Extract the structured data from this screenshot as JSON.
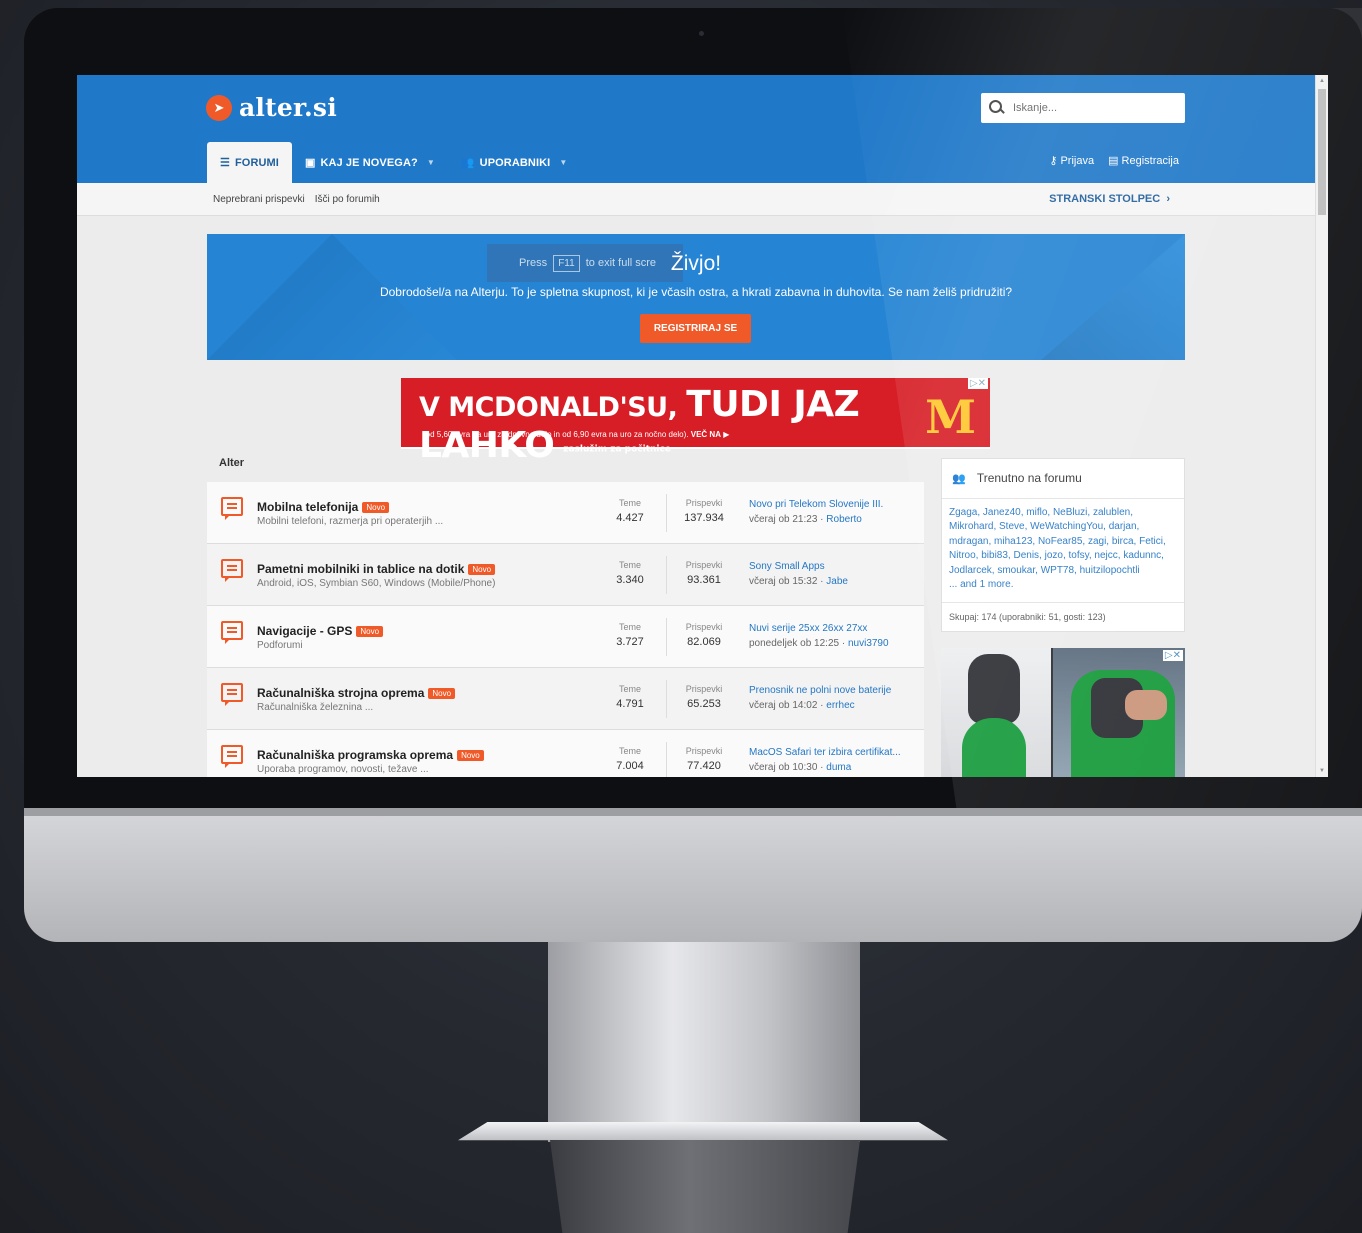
{
  "site": {
    "logo_text": "alter.si"
  },
  "search": {
    "placeholder": "Iskanje..."
  },
  "nav": {
    "tabs": [
      {
        "label": "FORUMI",
        "icon": "forum-icon"
      },
      {
        "label": "KAJ JE NOVEGA?",
        "icon": "comment-icon"
      },
      {
        "label": "UPORABNIKI",
        "icon": "users-icon"
      }
    ],
    "login": "Prijava",
    "register": "Registracija"
  },
  "subnav": {
    "unread": "Neprebrani prispevki",
    "search_forums": "Išči po forumih",
    "sidebar_toggle": "STRANSKI STOLPEC"
  },
  "fullscreen_hint": {
    "press": "Press",
    "key": "F11",
    "rest": "to exit full scre"
  },
  "banner": {
    "title": "Živjo!",
    "text": "Dobrodošel/a na Alterju. To je spletna skupnost, ki je včasih ostra, a hkrati zabavna in duhovita. Se nam želiš pridružiti?",
    "button": "REGISTRIRAJ SE"
  },
  "ad": {
    "headline_a": "V MCDONALD'SU,",
    "headline_b": "TUDI JAZ LAHKO",
    "headline_c": "zaslužim za počitnice",
    "subline": "(od 5,60 evra na uro za dnevno delo in od 6,90 evra na uro za nočno delo).",
    "cta": "VEČ NA",
    "brand_mark": "M"
  },
  "section": {
    "title": "Alter"
  },
  "forum_labels": {
    "threads": "Teme",
    "posts": "Prispevki",
    "new_badge": "Novo"
  },
  "forums": [
    {
      "name": "Mobilna telefonija",
      "desc": "Mobilni telefoni, razmerja pri operaterjih ...",
      "threads": "4.427",
      "posts": "137.934",
      "latest_title": "Novo pri Telekom Slovenije III.",
      "latest_time": "včeraj ob 21:23 ·",
      "latest_user": "Roberto"
    },
    {
      "name": "Pametni mobilniki in tablice na dotik",
      "desc": "Android, iOS, Symbian S60, Windows (Mobile/Phone)",
      "threads": "3.340",
      "posts": "93.361",
      "latest_title": "Sony Small Apps",
      "latest_time": "včeraj ob 15:32 ·",
      "latest_user": "Jabe"
    },
    {
      "name": "Navigacije - GPS",
      "desc": "Podforumi",
      "threads": "3.727",
      "posts": "82.069",
      "latest_title": "Nuvi serije 25xx 26xx 27xx",
      "latest_time": "ponedeljek ob 12:25 ·",
      "latest_user": "nuvi3790"
    },
    {
      "name": "Računalniška strojna oprema",
      "desc": "Računalniška železnina ...",
      "threads": "4.791",
      "posts": "65.253",
      "latest_title": "Prenosnik ne polni nove baterije",
      "latest_time": "včeraj ob 14:02 ·",
      "latest_user": "errhec"
    },
    {
      "name": "Računalniška programska oprema",
      "desc": "Uporaba programov, novosti, težave ...",
      "threads": "7.004",
      "posts": "77.420",
      "latest_title": "MacOS Safari ter izbira certifikat...",
      "latest_time": "včeraj ob 10:30 ·",
      "latest_user": "duma"
    }
  ],
  "online": {
    "title": "Trenutno na forumu",
    "users": "Zgaga, Janez40, miflo, NeBluzi, zalublen, Mikrohard, Steve, WeWatchingYou, darjan, mdragan, miha123, NoFear85, zagi, birca, Fetici, Nitroo, bibi83, Denis, jozo, tofsy, nejcc, kadunnc, Jodlarcek, smoukar, WPT78, huitzilopochtli",
    "more": "... and 1 more.",
    "total": "Skupaj: 174 (uporabniki: 51, gosti: 123)"
  },
  "colors": {
    "header": "#1f78c8",
    "accent": "#f05a28",
    "link": "#2577c4"
  }
}
